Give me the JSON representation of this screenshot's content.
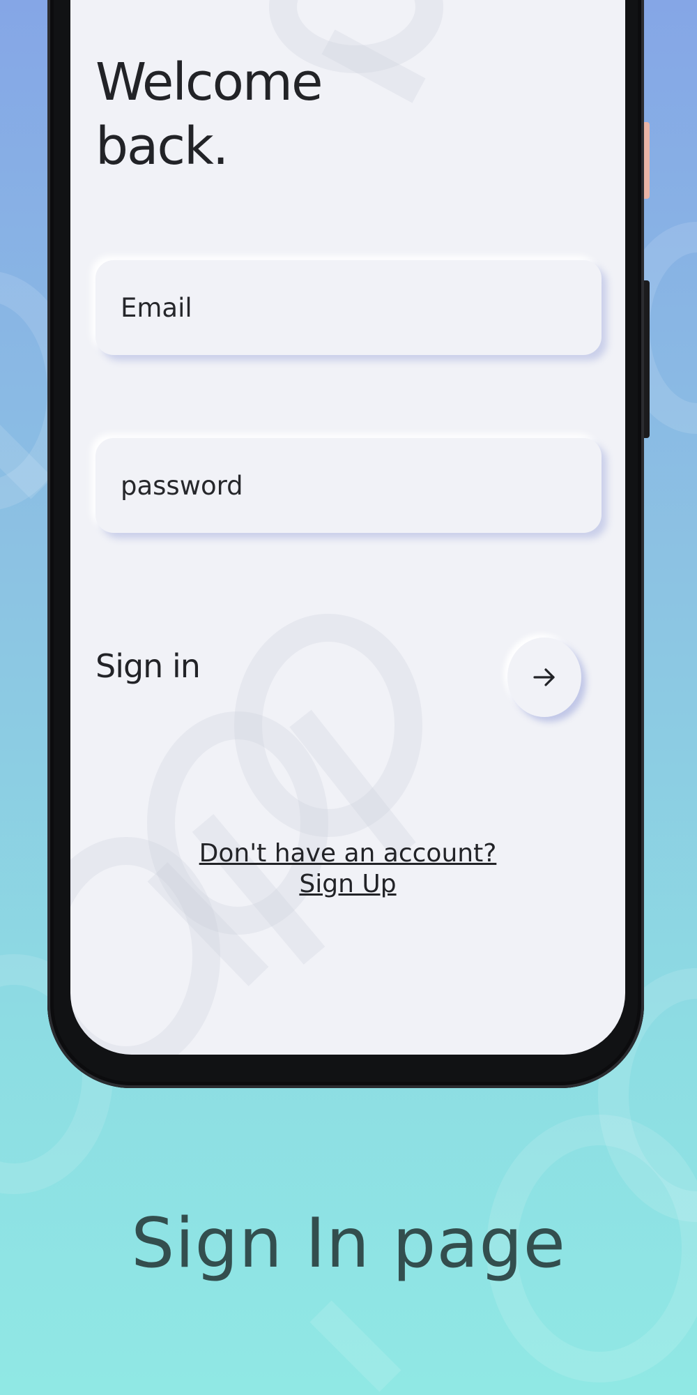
{
  "welcome": {
    "title": "Welcome\n back."
  },
  "form": {
    "email_placeholder": "Email",
    "password_placeholder": "password",
    "signin_label": "Sign in"
  },
  "footer": {
    "question": "Don't have an account?",
    "signup": "Sign Up"
  },
  "caption": "Sign In page",
  "icons": {
    "submit": "arrow-right-icon"
  },
  "colors": {
    "screen_bg": "#f1f2f7",
    "text": "#222327",
    "caption": "#334e4e",
    "gradient_top": "#85a6e6",
    "gradient_bottom": "#90e8e4"
  }
}
